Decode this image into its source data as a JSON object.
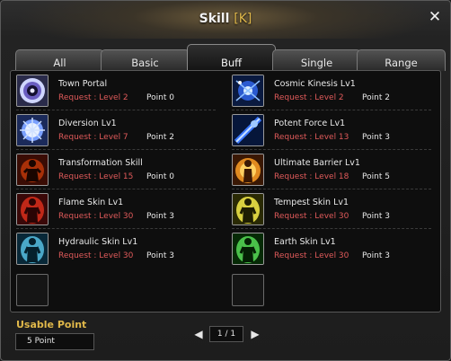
{
  "window": {
    "title": "Skill",
    "hotkey": "[K]",
    "close": "✕"
  },
  "tabs": [
    {
      "label": "All"
    },
    {
      "label": "Basic"
    },
    {
      "label": "Buff"
    },
    {
      "label": "Single"
    },
    {
      "label": "Range"
    }
  ],
  "active_tab": "Buff",
  "skills_left": [
    {
      "name": "Town Portal",
      "request": "Request : Level  2",
      "point": "Point  0",
      "icon": "portal-orb-icon"
    },
    {
      "name": "Diversion Lv1",
      "request": "Request : Level  7",
      "point": "Point  2",
      "icon": "diversion-icon"
    },
    {
      "name": "Transformation Skill",
      "request": "Request : Level 15",
      "point": "Point  0",
      "icon": "transformation-icon"
    },
    {
      "name": "Flame Skin Lv1",
      "request": "Request : Level 30",
      "point": "Point  3",
      "icon": "flame-skin-icon"
    },
    {
      "name": "Hydraulic Skin Lv1",
      "request": "Request : Level 30",
      "point": "Point  3",
      "icon": "hydraulic-skin-icon"
    }
  ],
  "skills_right": [
    {
      "name": "Cosmic Kinesis Lv1",
      "request": "Request : Level  2",
      "point": "Point  2",
      "icon": "cosmic-kinesis-icon"
    },
    {
      "name": "Potent Force Lv1",
      "request": "Request : Level 13",
      "point": "Point  3",
      "icon": "potent-force-icon"
    },
    {
      "name": "Ultimate Barrier Lv1",
      "request": "Request : Level 18",
      "point": "Point  5",
      "icon": "ultimate-barrier-icon"
    },
    {
      "name": "Tempest Skin Lv1",
      "request": "Request : Level 30",
      "point": "Point  3",
      "icon": "tempest-skin-icon"
    },
    {
      "name": "Earth Skin Lv1",
      "request": "Request : Level 30",
      "point": "Point  3",
      "icon": "earth-skin-icon"
    }
  ],
  "usable_point": {
    "label": "Usable Point",
    "value": "5 Point"
  },
  "pagination": {
    "page": "1 / 1",
    "prev": "◀",
    "next": "▶"
  },
  "colors": {
    "accent_gold": "#e0b84a",
    "request_red": "#e05a5a",
    "text": "#e8e8e8"
  }
}
